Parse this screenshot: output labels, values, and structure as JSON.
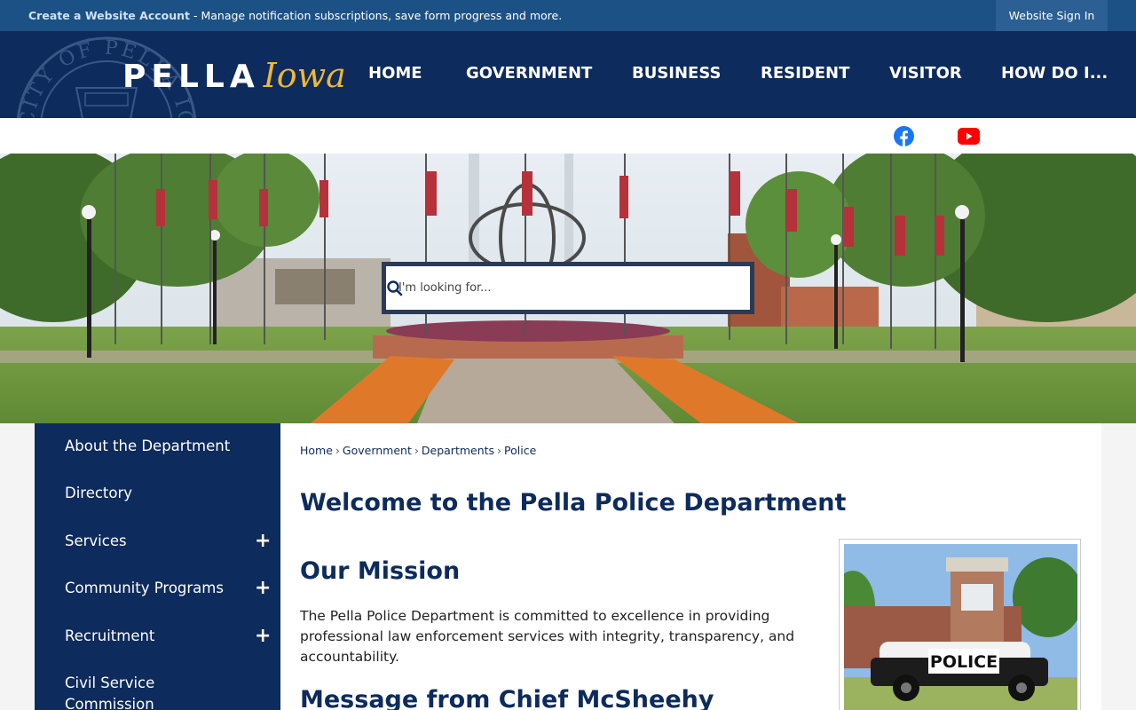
{
  "topbar": {
    "create_link": "Create a Website Account",
    "create_rest": " - Manage notification subscriptions, save form progress and more.",
    "sign_in": "Website Sign In"
  },
  "header": {
    "logo_main": "PELLA",
    "logo_script": "Iowa",
    "seal_text": "CITY OF PELLA IOWA",
    "nav": [
      "HOME",
      "GOVERNMENT",
      "BUSINESS",
      "RESIDENT",
      "VISITOR",
      "HOW DO I..."
    ]
  },
  "social": {
    "icons": [
      "facebook-icon",
      "youtube-icon"
    ]
  },
  "search": {
    "placeholder": "I'm looking for...",
    "icon": "search-icon"
  },
  "sidebar": {
    "items": [
      {
        "label": "About the Department",
        "expandable": false
      },
      {
        "label": "Directory",
        "expandable": false
      },
      {
        "label": "Services",
        "expandable": true
      },
      {
        "label": "Community Programs",
        "expandable": true
      },
      {
        "label": "Recruitment",
        "expandable": true
      },
      {
        "label": "Civil Service Commission",
        "expandable": false
      }
    ],
    "expand_symbol": "+"
  },
  "breadcrumb": [
    "Home",
    "Government",
    "Departments",
    "Police"
  ],
  "breadcrumb_sep": "›",
  "main": {
    "title": "Welcome to the Pella Police Department",
    "mission_heading": "Our Mission",
    "mission_text": "The Pella Police Department is committed to excellence in providing professional law enforcement services with integrity, transparency, and accountability.",
    "message_heading": "Message from Chief McSheehy",
    "photo_text": "POLICE"
  },
  "colors": {
    "navy": "#0d2b5c",
    "topbar": "#1c5185",
    "gold": "#f0b830",
    "facebook": "#1877f2",
    "youtube": "#ff0000"
  }
}
